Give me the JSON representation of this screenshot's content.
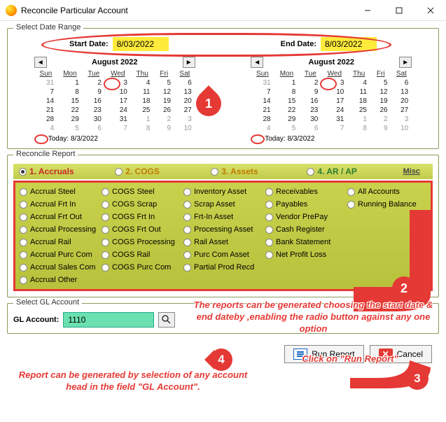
{
  "window": {
    "title": "Reconcile Particular Account"
  },
  "date_range": {
    "legend": "Select Date Range",
    "start_label": "Start Date:",
    "start_value": "8/03/2022",
    "end_label": "End Date:",
    "end_value": "8/03/2022"
  },
  "calendar": {
    "title": "August 2022",
    "dow": [
      "Sun",
      "Mon",
      "Tue",
      "Wed",
      "Thu",
      "Fri",
      "Sat"
    ],
    "weeks": [
      [
        {
          "d": "31",
          "dim": true
        },
        {
          "d": "1"
        },
        {
          "d": "2"
        },
        {
          "d": "3",
          "hl": true
        },
        {
          "d": "4"
        },
        {
          "d": "5"
        },
        {
          "d": "6"
        }
      ],
      [
        {
          "d": "7"
        },
        {
          "d": "8"
        },
        {
          "d": "9"
        },
        {
          "d": "10"
        },
        {
          "d": "11"
        },
        {
          "d": "12"
        },
        {
          "d": "13"
        }
      ],
      [
        {
          "d": "14"
        },
        {
          "d": "15"
        },
        {
          "d": "16"
        },
        {
          "d": "17"
        },
        {
          "d": "18"
        },
        {
          "d": "19"
        },
        {
          "d": "20"
        }
      ],
      [
        {
          "d": "21"
        },
        {
          "d": "22"
        },
        {
          "d": "23"
        },
        {
          "d": "24"
        },
        {
          "d": "25"
        },
        {
          "d": "26"
        },
        {
          "d": "27"
        }
      ],
      [
        {
          "d": "28"
        },
        {
          "d": "29"
        },
        {
          "d": "30"
        },
        {
          "d": "31"
        },
        {
          "d": "1",
          "dim": true
        },
        {
          "d": "2",
          "dim": true
        },
        {
          "d": "3",
          "dim": true
        }
      ],
      [
        {
          "d": "4",
          "dim": true
        },
        {
          "d": "5",
          "dim": true
        },
        {
          "d": "6",
          "dim": true
        },
        {
          "d": "7",
          "dim": true
        },
        {
          "d": "8",
          "dim": true
        },
        {
          "d": "9",
          "dim": true
        },
        {
          "d": "10",
          "dim": true
        }
      ]
    ],
    "today": "Today: 8/3/2022"
  },
  "report": {
    "legend": "Reconcile Report",
    "heads": [
      {
        "label": "1. Accruals",
        "cls": "c-red",
        "on": true
      },
      {
        "label": "2. COGS",
        "cls": "c-orange",
        "on": false
      },
      {
        "label": "3. Assets",
        "cls": "c-orange",
        "on": false
      },
      {
        "label": "4. AR / AP",
        "cls": "c-green",
        "on": false
      }
    ],
    "misc": "Misc",
    "cols": [
      [
        "Accrual Steel",
        "Accrual Frt In",
        "Accrual Frt Out",
        "Accrual Processing",
        "Accrual Rail",
        "Accrual Purc Com",
        "Accrual Sales Com",
        "Accrual Other"
      ],
      [
        "COGS Steel",
        "COGS Scrap",
        "COGS Frt In",
        "COGS Frt Out",
        "COGS Processing",
        "COGS Rail",
        "COGS Purc Com"
      ],
      [
        "Inventory Asset",
        "Scrap Asset",
        "Frt-In Asset",
        "Processing Asset",
        "Rail Asset",
        "Purc Com Asset",
        "Partial Prod Recd"
      ],
      [
        "Receivables",
        "Payables",
        "Vendor PrePay",
        "Cash Register",
        "Bank Statement",
        "Net Profit Loss"
      ],
      [
        "All Accounts",
        "Running Balance"
      ]
    ]
  },
  "gl": {
    "legend": "Select GL Account",
    "label": "GL Account:",
    "value": "1110"
  },
  "buttons": {
    "run": "Run Report",
    "cancel": "Cancel"
  },
  "annotations": {
    "n1": "1",
    "n2": "2",
    "n3": "3",
    "n4": "4",
    "text_report": "The reports can be generated choosing the start date & end dateby ,enabling the radio button against any one option",
    "text_click": "Click on \"Run Report\"",
    "text_gl": "Report can be generated by selection of any account head in the field \"GL Account\"."
  }
}
